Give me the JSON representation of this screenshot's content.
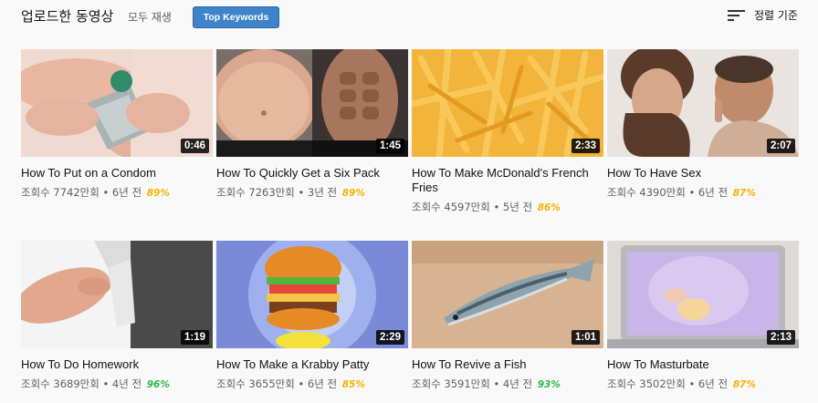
{
  "header": {
    "title": "업로드한 동영상",
    "play_all": "모두 재생",
    "top_keywords": "Top Keywords",
    "sort_label": "정렬 기준"
  },
  "colors": {
    "button_blue": "#3f83c8",
    "pct_yellow": "#f5b300",
    "pct_green": "#2db84d"
  },
  "videos": [
    {
      "title": "How To Put on a Condom",
      "duration": "0:46",
      "meta": "조회수 7742만회 • 6년 전",
      "pct": "89%",
      "pct_color": "#f5b300"
    },
    {
      "title": "How To Quickly Get a Six Pack",
      "duration": "1:45",
      "meta": "조회수 7263만회 • 3년 전",
      "pct": "89%",
      "pct_color": "#f5b300"
    },
    {
      "title": "How To Make McDonald's French Fries",
      "duration": "2:33",
      "meta": "조회수 4597만회 • 5년 전",
      "pct": "86%",
      "pct_color": "#f5b300"
    },
    {
      "title": "How To Have Sex",
      "duration": "2:07",
      "meta": "조회수 4390만회 • 6년 전",
      "pct": "87%",
      "pct_color": "#f5b300"
    },
    {
      "title": "How To Do Homework",
      "duration": "1:19",
      "meta": "조회수 3689만회 • 4년 전",
      "pct": "96%",
      "pct_color": "#2db84d"
    },
    {
      "title": "How To Make a Krabby Patty",
      "duration": "2:29",
      "meta": "조회수 3655만회 • 6년 전",
      "pct": "85%",
      "pct_color": "#f5b300"
    },
    {
      "title": "How To Revive a Fish",
      "duration": "1:01",
      "meta": "조회수 3591만회 • 4년 전",
      "pct": "93%",
      "pct_color": "#2db84d"
    },
    {
      "title": "How To Masturbate",
      "duration": "2:13",
      "meta": "조회수 3502만회 • 6년 전",
      "pct": "87%",
      "pct_color": "#f5b300"
    }
  ]
}
